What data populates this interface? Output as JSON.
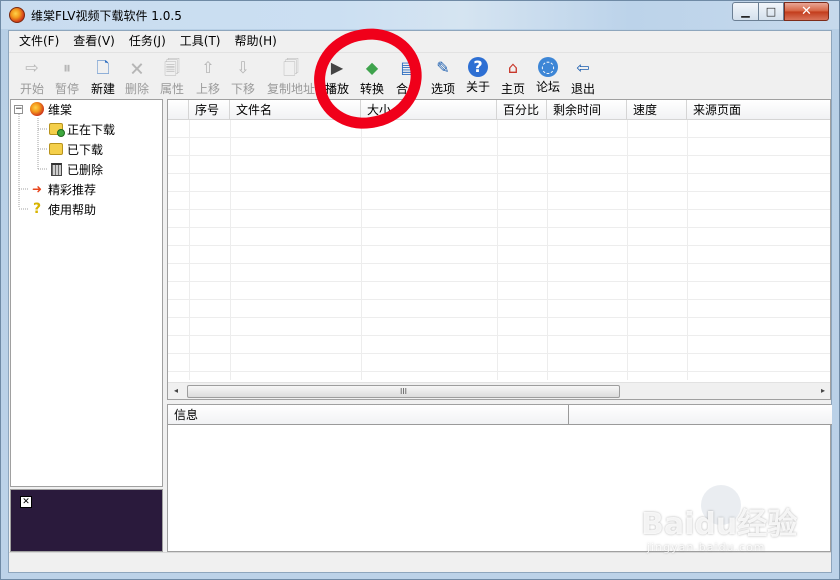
{
  "window": {
    "title": "维棠FLV视频下载软件 1.0.5",
    "min_glyph": "▁",
    "max_glyph": "□",
    "close_glyph": "✕"
  },
  "menu": [
    "文件(F)",
    "查看(V)",
    "任务(J)",
    "工具(T)",
    "帮助(H)"
  ],
  "toolbar": [
    {
      "label": "开始",
      "icon": "play-icon",
      "glyph": "⇨",
      "enabled": false
    },
    {
      "label": "暂停",
      "icon": "pause-icon",
      "glyph": "⏸",
      "enabled": false
    },
    {
      "label": "新建",
      "icon": "new-file-icon",
      "glyph": "🗋",
      "enabled": true
    },
    {
      "label": "删除",
      "icon": "delete-icon",
      "glyph": "🗙",
      "enabled": false
    },
    {
      "label": "属性",
      "icon": "properties-icon",
      "glyph": "🗐",
      "enabled": false
    },
    {
      "label": "上移",
      "icon": "move-up-icon",
      "glyph": "⇧",
      "enabled": false
    },
    {
      "label": "下移",
      "icon": "move-down-icon",
      "glyph": "⇩",
      "enabled": false
    },
    {
      "label": "复制地址",
      "icon": "copy-icon",
      "glyph": "🗍",
      "enabled": false
    },
    {
      "label": "播放",
      "icon": "play-media-icon",
      "glyph": "▶",
      "enabled": true
    },
    {
      "label": "转换",
      "icon": "convert-icon",
      "glyph": "◆",
      "enabled": true
    },
    {
      "label": "合并",
      "icon": "merge-icon",
      "glyph": "▤",
      "enabled": true
    },
    {
      "label": "选项",
      "icon": "options-icon",
      "glyph": "✎",
      "enabled": true
    },
    {
      "label": "关于",
      "icon": "help-icon",
      "glyph": "?",
      "enabled": true
    },
    {
      "label": "主页",
      "icon": "home-icon",
      "glyph": "⌂",
      "enabled": true
    },
    {
      "label": "论坛",
      "icon": "forum-icon",
      "glyph": "◌",
      "enabled": true
    },
    {
      "label": "退出",
      "icon": "exit-icon",
      "glyph": "⇦",
      "enabled": true
    }
  ],
  "tree": {
    "root": "维棠",
    "root_expander": "−",
    "children": [
      "正在下载",
      "已下载",
      "已删除"
    ],
    "items": [
      "精彩推荐",
      "使用帮助"
    ]
  },
  "grid": {
    "columns": [
      "",
      "序号",
      "文件名",
      "大小",
      "百分比",
      "剩余时间",
      "速度",
      "来源页面"
    ],
    "hscroll_left": "◂",
    "hscroll_right": "▸",
    "hscroll_grip": "III"
  },
  "info": {
    "columns": [
      "信息",
      ""
    ]
  },
  "ad": {
    "close_glyph": "✕"
  },
  "watermark": {
    "logo": "Baidu经验",
    "url": "jingyan.baidu.com"
  },
  "colors": {
    "highlight_circle": "#f0001a",
    "ad_background": "#2a1a3c"
  }
}
